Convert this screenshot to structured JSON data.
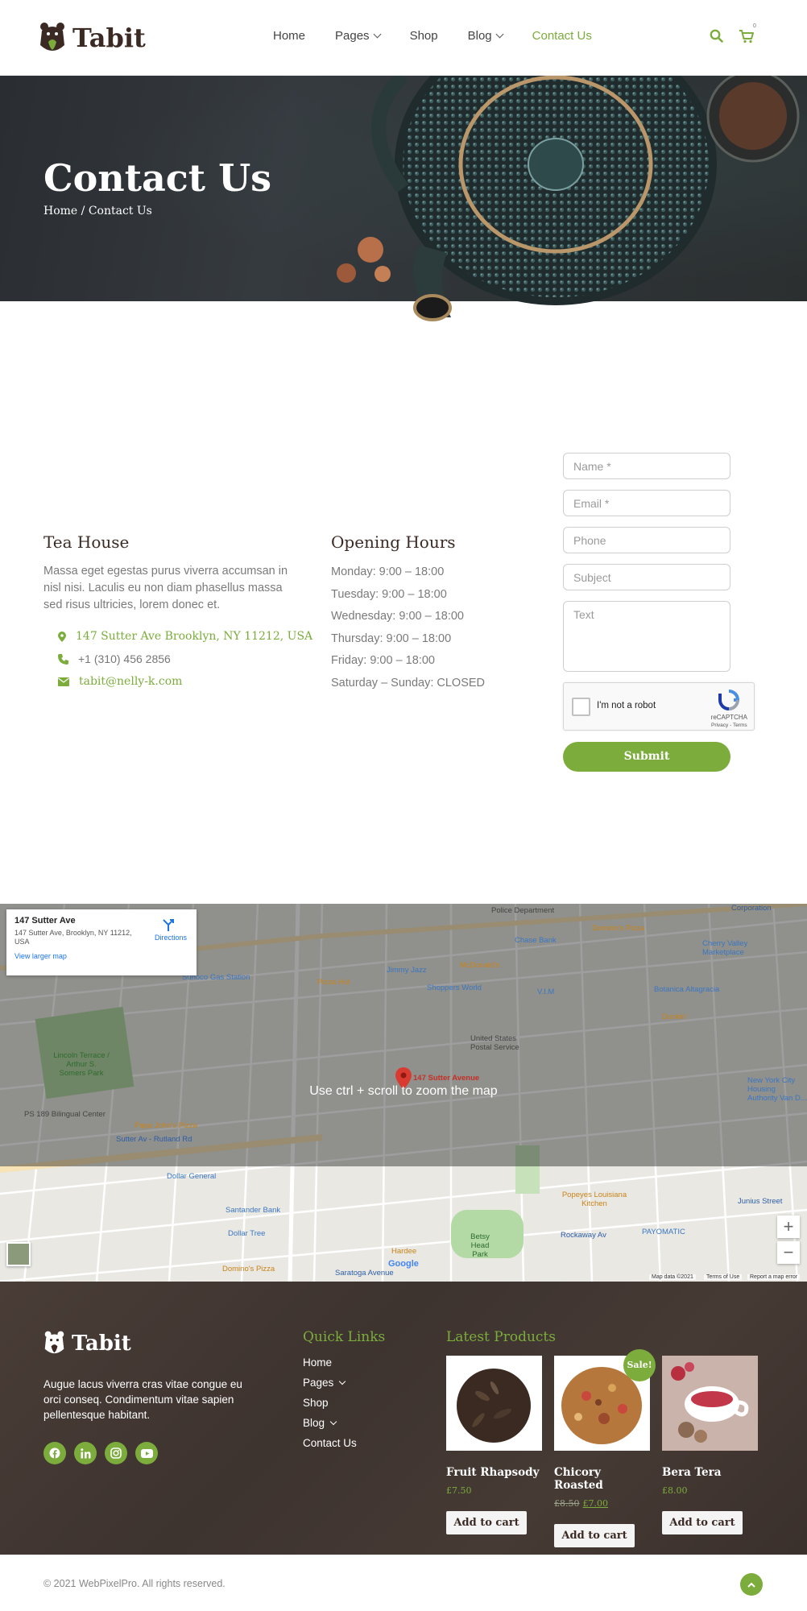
{
  "brand": {
    "name": "Tabit",
    "accent": "#7bac3c",
    "dark": "#3b2a24"
  },
  "nav": {
    "items": [
      {
        "label": "Home",
        "has_dropdown": false,
        "active": false
      },
      {
        "label": "Pages",
        "has_dropdown": true,
        "active": false
      },
      {
        "label": "Shop",
        "has_dropdown": false,
        "active": false
      },
      {
        "label": "Blog",
        "has_dropdown": true,
        "active": false
      },
      {
        "label": "Contact Us",
        "has_dropdown": false,
        "active": true
      }
    ],
    "cart_count": "0",
    "icons": [
      "search-icon",
      "cart-icon"
    ]
  },
  "hero": {
    "title": "Contact Us",
    "breadcrumb": "Home / Contact Us"
  },
  "tea_house": {
    "title": "Tea House",
    "text": "Massa eget egestas purus viverra accumsan in nisl nisi. Laculis eu non diam phasellus massa sed risus ultricies, lorem donec et.",
    "address": "147 Sutter Ave Brooklyn, NY 11212, USA",
    "phone": "+1 (310) 456 2856",
    "email": "tabit@nelly-k.com"
  },
  "hours": {
    "title": "Opening Hours",
    "lines": [
      "Monday: 9:00 – 18:00",
      "Tuesday: 9:00 – 18:00",
      "Wednesday: 9:00 – 18:00",
      "Thursday: 9:00 – 18:00",
      "Friday: 9:00 – 18:00",
      "Saturday – Sunday: CLOSED"
    ]
  },
  "form": {
    "name_placeholder": "Name *",
    "email_placeholder": "Email *",
    "phone_placeholder": "Phone",
    "subject_placeholder": "Subject",
    "text_placeholder": "Text",
    "recaptcha_label": "I'm not a robot",
    "recaptcha_brand": "reCAPTCHA",
    "recaptcha_links": "Privacy - Terms",
    "submit_label": "Submit"
  },
  "map": {
    "card_name": "147 Sutter Ave",
    "card_address": "147 Sutter Ave, Brooklyn, NY 11212, USA",
    "directions": "Directions",
    "larger_map": "View larger map",
    "overlay": "Use ctrl + scroll to zoom the map",
    "pin_label": "147 Sutter Avenue",
    "attribution": "Map data ©2021",
    "terms": "Terms of Use",
    "report": "Report a map error",
    "google": "Google",
    "places": {
      "sunoco": "Sunoco Gas Station",
      "pizza_hut": "Pizza Hut",
      "jimmy_jazz": "Jimmy Jazz",
      "mcdonalds": "McDonald's",
      "shoppers": "Shoppers World",
      "chase": "Chase Bank",
      "dominos1": "Domino's Pizza",
      "cherry": "Cherry Valley Marketplace",
      "vim": "V.I.M",
      "botanica": "Botanica Altagracia",
      "dunkin": "Dunkin'",
      "usps": "United States Postal Service",
      "lincoln": "Lincoln Terrace / Arthur S. Somers Park",
      "ps189": "PS 189 Bilingual Center",
      "papa": "Papa John's Pizza",
      "sutter_rutland": "Sutter Av - Rutland Rd",
      "nyc_housing": "New York City Housing Authority Van D...",
      "dollar_general": "Dollar General",
      "santander": "Santander Bank",
      "dollar_tree": "Dollar Tree",
      "dominos2": "Domino's Pizza",
      "saratoga": "Saratoga Avenue",
      "hardee": "Hardee",
      "betsy": "Betsy Head Park",
      "popeyes": "Popeyes Louisiana Kitchen",
      "rockaway": "Rockaway Av",
      "payomatic": "PAYOMATIC",
      "junius": "Junius Street",
      "corporation": "Corporation",
      "police": "Police Department"
    }
  },
  "footer": {
    "logo": "Tabit",
    "text": "Augue lacus viverra cras vitae congue eu orci conseq. Condimentum vitae sapien pellentesque habitant.",
    "quick_links_title": "Quick Links",
    "quick_links": [
      {
        "label": "Home",
        "has_dropdown": false
      },
      {
        "label": "Pages",
        "has_dropdown": true
      },
      {
        "label": "Shop",
        "has_dropdown": false
      },
      {
        "label": "Blog",
        "has_dropdown": true
      },
      {
        "label": "Contact Us",
        "has_dropdown": false
      }
    ],
    "latest_title": "Latest Products",
    "products": [
      {
        "name": "Fruit Rhapsody",
        "old_price": "",
        "price": "£7.50",
        "button": "Add to cart"
      },
      {
        "name": "Chicory Roasted",
        "old_price": "£8.50",
        "price": "£7.00",
        "button": "Add to cart",
        "badge": "Sale!"
      },
      {
        "name": "Bera Tera",
        "old_price": "",
        "price": "£8.00",
        "button": "Add to cart"
      }
    ],
    "socials": [
      "facebook-icon",
      "linkedin-icon",
      "instagram-icon",
      "youtube-icon"
    ],
    "copyright": "© 2021 WebPixelPro. All rights reserved."
  }
}
